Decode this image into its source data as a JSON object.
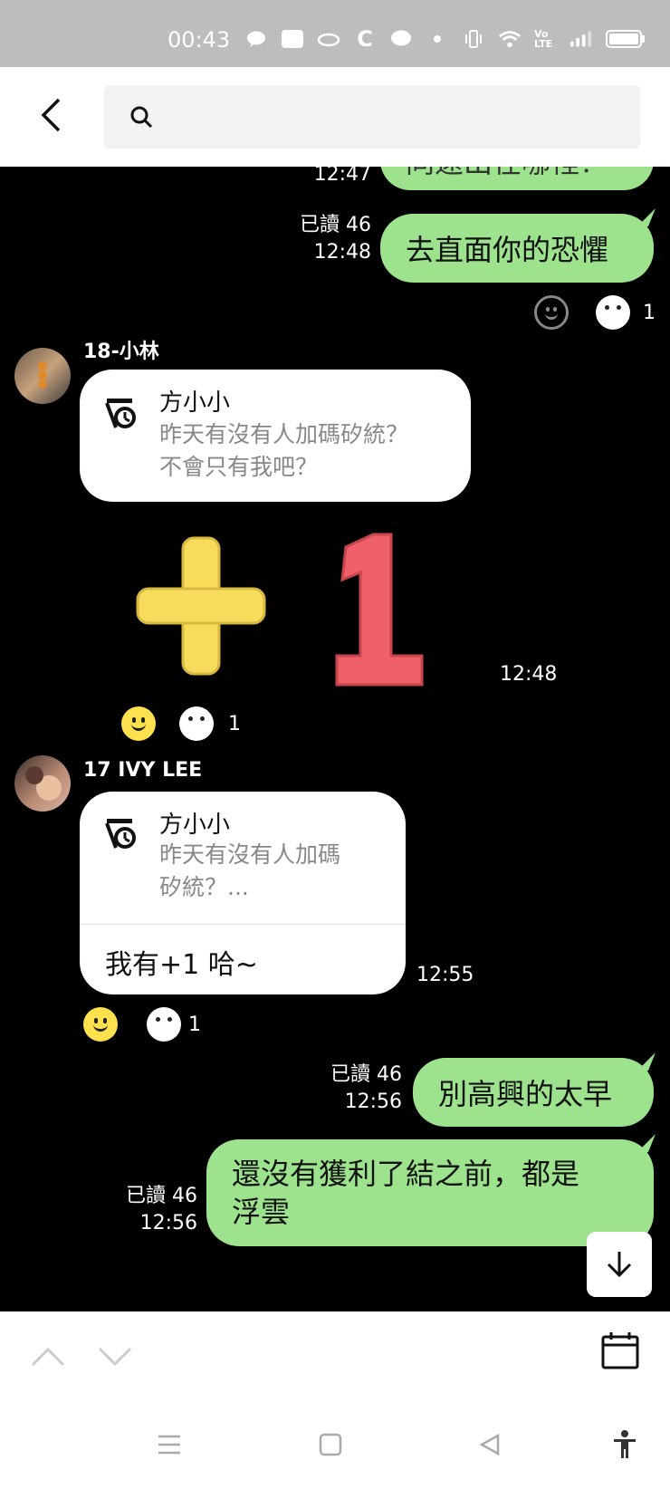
{
  "status_bar": {
    "time": "00:43",
    "icons": [
      "chat-bubble-icon",
      "play-store-icon",
      "cloud-icon",
      "c-app-icon",
      "line-icon",
      "dot-icon",
      "vibrate-icon",
      "wifi-icon",
      "volte-icon",
      "signal-icon",
      "battery-icon"
    ],
    "play_label": "PLAY",
    "volte_label": "Vo LTE"
  },
  "search": {
    "placeholder": ""
  },
  "messages": {
    "m1": {
      "text": "同遠出在哪裡？",
      "time": "12:47"
    },
    "m2": {
      "read": "已讀 46",
      "time": "12:48",
      "text": "去直面你的恐懼"
    },
    "m2_reaction_count": "1",
    "m3": {
      "sender": "18-小林",
      "quote_title": "方小小",
      "quote_body_line1": "昨天有沒有人加碼矽統？",
      "quote_body_line2": "不會只有我吧？",
      "sticker_text": "+1",
      "time": "12:48",
      "reaction_count": "1"
    },
    "m4": {
      "sender": "17 IVY LEE",
      "quote_title": "方小小",
      "quote_body_line1": "昨天有沒有人加碼",
      "quote_body_line2": "矽統？...",
      "reply": "我有+1 哈~",
      "time": "12:55",
      "reaction_count": "1"
    },
    "m5": {
      "read": "已讀 46",
      "time": "12:56",
      "text": "別高興的太早"
    },
    "m6": {
      "read": "已讀 46",
      "time": "12:56",
      "text_line1": "還沒有獲利了結之前，都是",
      "text_line2": "浮雲"
    }
  },
  "colors": {
    "bubble_green": "#9de28c",
    "sticker_plus": "#f7dc5c",
    "sticker_one": "#f0606a"
  }
}
